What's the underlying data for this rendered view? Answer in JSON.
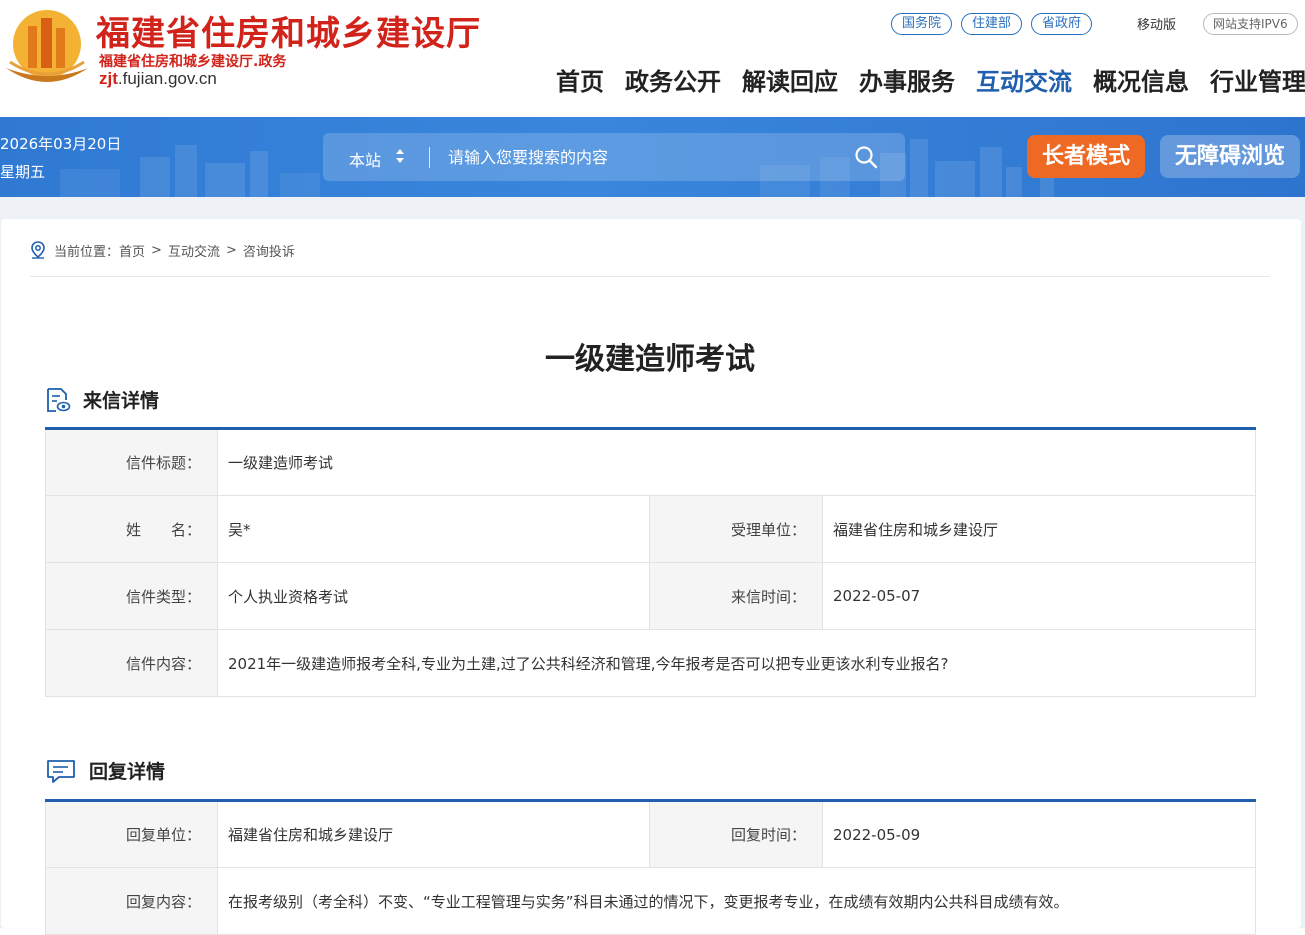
{
  "header": {
    "site_title": "福建省住房和城乡建设厅",
    "site_subtitle": "福建省住房和城乡建设厅.政务",
    "domain_bold": "zjt",
    "domain_rest": ".fujian.gov.cn",
    "top_links": [
      "国务院",
      "住建部",
      "省政府"
    ],
    "mobile": "移动版",
    "ipv6": "网站支持IPV6",
    "nav": [
      "首页",
      "政务公开",
      "解读回应",
      "办事服务",
      "互动交流",
      "概况信息",
      "行业管理"
    ],
    "nav_active": "互动交流"
  },
  "banner": {
    "date": "2026年03月20日",
    "weekday": "星期五",
    "search_scope": "本站",
    "search_placeholder": "请输入您要搜索的内容",
    "elder_mode": "长者模式",
    "accessible": "无障碍浏览"
  },
  "breadcrumb": {
    "prefix": "当前位置：",
    "items": [
      "首页",
      "互动交流",
      "咨询投诉"
    ],
    "separator": ">"
  },
  "page_title": "一级建造师考试",
  "letter": {
    "heading": "来信详情",
    "title_label": "信件标题：",
    "title_value": "一级建造师考试",
    "name_label": "姓　　名：",
    "name_value": "吴*",
    "unit_label": "受理单位：",
    "unit_value": "福建省住房和城乡建设厅",
    "type_label": "信件类型：",
    "type_value": "个人执业资格考试",
    "time_label": "来信时间：",
    "time_value": "2022-05-07",
    "content_label": "信件内容：",
    "content_value": "2021年一级建造师报考全科,专业为土建,过了公共科经济和管理,今年报考是否可以把专业更该水利专业报名?"
  },
  "reply": {
    "heading": "回复详情",
    "unit_label": "回复单位：",
    "unit_value": "福建省住房和城乡建设厅",
    "time_label": "回复时间：",
    "time_value": "2022-05-09",
    "content_label": "回复内容：",
    "content_value": "在报考级别（考全科）不变、“专业工程管理与实务”科目未通过的情况下，变更报考专业，在成绩有效期内公共科目成绩有效。"
  },
  "colors": {
    "brand_red": "#d2231b",
    "nav_active_blue": "#1f5fae",
    "banner_blue": "#3a86dc",
    "elder_orange": "#ee6a24"
  }
}
